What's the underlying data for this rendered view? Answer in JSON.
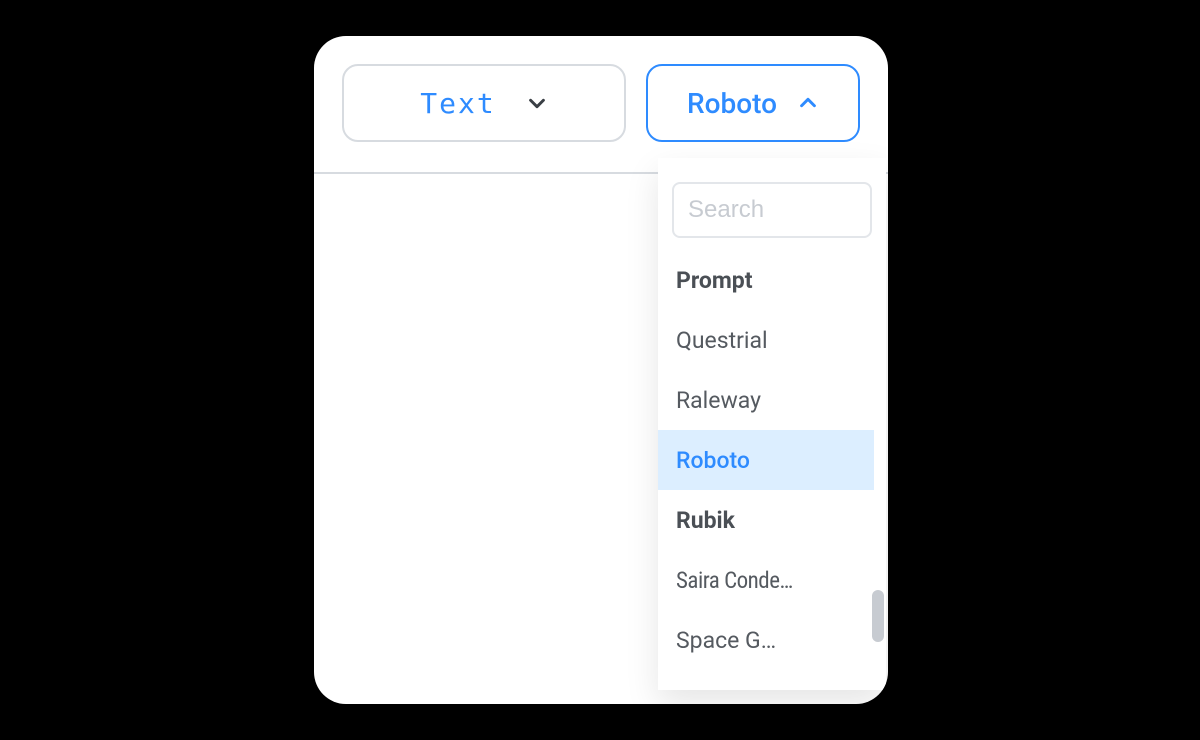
{
  "toolbar": {
    "type_dropdown": {
      "label": "Text",
      "open": false
    },
    "font_dropdown": {
      "label": "Roboto",
      "open": true
    }
  },
  "font_menu": {
    "search_placeholder": "Search",
    "selected": "Roboto",
    "options": [
      {
        "label": "Prompt",
        "bold": true
      },
      {
        "label": "Questrial",
        "bold": false
      },
      {
        "label": "Raleway",
        "bold": false
      },
      {
        "label": "Roboto",
        "bold": false,
        "selected": true
      },
      {
        "label": "Rubik",
        "bold": true
      },
      {
        "label": "Saira Conde…",
        "bold": false,
        "condensed": true
      },
      {
        "label": "Space G…",
        "bold": false
      }
    ]
  },
  "colors": {
    "accent": "#2e8bff",
    "highlight_bg": "#dceeff",
    "border": "#d7dbe0",
    "text_muted": "#555a60"
  }
}
